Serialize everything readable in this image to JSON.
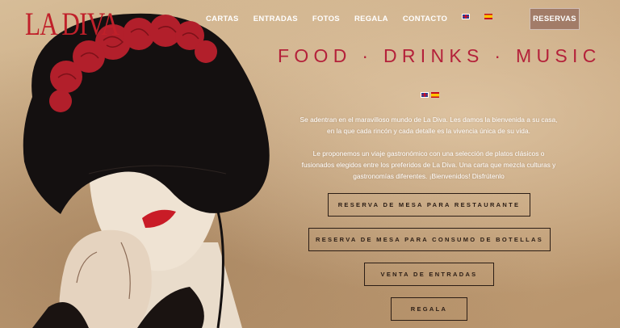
{
  "brand": {
    "logo_text": "LA DIVA",
    "color": "#c0202a"
  },
  "nav": {
    "items": [
      {
        "label": "CARTAS"
      },
      {
        "label": "ENTRADAS"
      },
      {
        "label": "FOTOS"
      },
      {
        "label": "REGALA"
      },
      {
        "label": "CONTACTO"
      }
    ],
    "language_flags": [
      "english-flag-icon",
      "spanish-flag-icon"
    ],
    "reservas_label": "RESERVAS"
  },
  "hero": {
    "tagline": "FOOD · DRINKS · MUSIC",
    "tagline_color": "#b4213a",
    "intro_paragraph_1": "Se adentran en el maravilloso mundo de La Diva. Les damos la bienvenida a su casa, en la que cada rincón y cada detalle es la vivencia única de su vida.",
    "intro_paragraph_2": "Le proponemos un viaje gastronómico con una selección de platos clásicos o fusionados elegidos entre los preferidos de La Diva. Una carta que mezcla culturas y gastronomías diferentes. ¡Bienvenidos! Disfrútenlo"
  },
  "actions": {
    "restaurant_reservation": "RESERVA DE MESA PARA RESTAURANTE",
    "bottle_reservation": "RESERVA DE MESA PARA CONSUMO DE BOTELLAS",
    "ticket_sales": "VENTA DE ENTRADAS",
    "gift": "REGALA"
  }
}
